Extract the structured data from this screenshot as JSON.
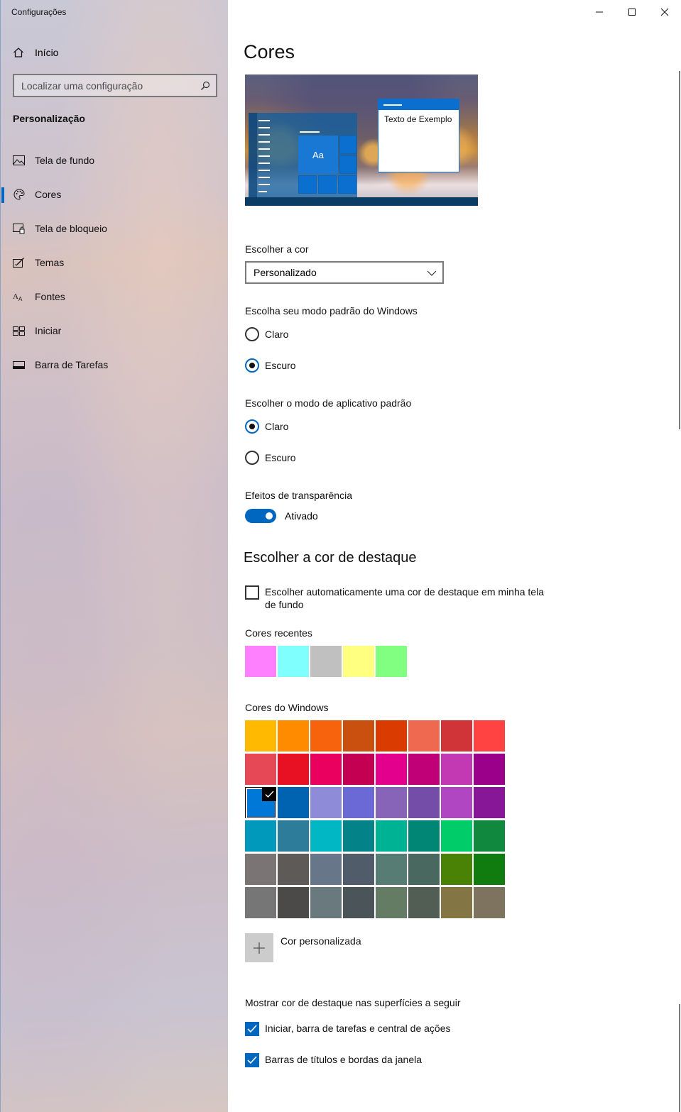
{
  "sidebar": {
    "app_title": "Configurações",
    "home_label": "Início",
    "search_placeholder": "Localizar uma configuração",
    "section_title": "Personalização",
    "items": [
      {
        "label": "Tela de fundo",
        "icon": "image-icon"
      },
      {
        "label": "Cores",
        "icon": "palette-icon",
        "active": true
      },
      {
        "label": "Tela de bloqueio",
        "icon": "lock-screen-icon"
      },
      {
        "label": "Temas",
        "icon": "themes-icon"
      },
      {
        "label": "Fontes",
        "icon": "fonts-icon"
      },
      {
        "label": "Iniciar",
        "icon": "start-icon"
      },
      {
        "label": "Barra de Tarefas",
        "icon": "taskbar-icon"
      }
    ]
  },
  "main": {
    "title": "Cores",
    "preview_sample_text": "Texto de Exemplo",
    "preview_tile_text": "Aa",
    "choose_color_label": "Escolher a cor",
    "choose_color_value": "Personalizado",
    "windows_mode_label": "Escolha seu modo padrão do Windows",
    "windows_mode_options": [
      "Claro",
      "Escuro"
    ],
    "windows_mode_selected": "Escuro",
    "app_mode_label": "Escolher o modo de aplicativo padrão",
    "app_mode_options": [
      "Claro",
      "Escuro"
    ],
    "app_mode_selected": "Claro",
    "transparency_label": "Efeitos de transparência",
    "transparency_state": "Ativado",
    "accent_heading": "Escolher a cor de destaque",
    "auto_accent_label": "Escolher automaticamente uma cor de destaque em minha tela de fundo",
    "recent_colors_label": "Cores recentes",
    "recent_colors": [
      "#ff80ff",
      "#80ffff",
      "#c0c0c0",
      "#ffff80",
      "#80ff80"
    ],
    "windows_colors_label": "Cores do Windows",
    "windows_colors": [
      [
        "#ffb900",
        "#ff8c00",
        "#f7630c",
        "#ca5010",
        "#da3b01",
        "#ef6950",
        "#d13438",
        "#ff4343"
      ],
      [
        "#e74856",
        "#e81123",
        "#ea005e",
        "#c30052",
        "#e3008c",
        "#bf0077",
        "#c239b3",
        "#9a0089"
      ],
      [
        "#0078d7",
        "#0063b1",
        "#8e8cd8",
        "#6b69d6",
        "#8764b8",
        "#744da9",
        "#b146c2",
        "#881798"
      ],
      [
        "#0099bc",
        "#2d7d9a",
        "#00b7c3",
        "#038387",
        "#00b294",
        "#018574",
        "#00cc6a",
        "#10893e"
      ],
      [
        "#7a7574",
        "#5d5a58",
        "#68768a",
        "#515c6b",
        "#567c73",
        "#486860",
        "#498205",
        "#107c10"
      ],
      [
        "#767676",
        "#4c4a48",
        "#69797e",
        "#4a5459",
        "#647c64",
        "#525e54",
        "#847545",
        "#7e735f"
      ]
    ],
    "selected_color": "#0078d7",
    "custom_color_label": "Cor personalizada",
    "surfaces_label": "Mostrar cor de destaque nas superfícies a seguir",
    "surface_start_label": "Iniciar, barra de tarefas e central de ações",
    "surface_titlebar_label": "Barras de títulos e bordas da janela"
  },
  "colors": {
    "accent": "#0067c0"
  }
}
